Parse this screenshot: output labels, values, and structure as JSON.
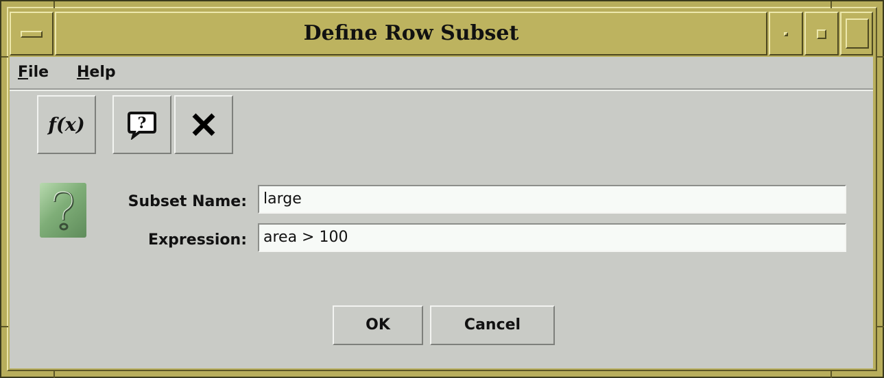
{
  "window": {
    "title": "Define Row Subset"
  },
  "menu": {
    "file": {
      "mnemonic": "F",
      "rest": "ile"
    },
    "help": {
      "mnemonic": "H",
      "rest": "elp"
    }
  },
  "toolbar": {
    "functions_label": "f(x)",
    "help_label": "?",
    "close_label": "✕"
  },
  "form": {
    "subset_name_label": "Subset Name:",
    "subset_name_value": "large",
    "expression_label": "Expression:",
    "expression_value": "area > 100"
  },
  "buttons": {
    "ok_label": "OK",
    "cancel_label": "Cancel"
  },
  "icons": {
    "window_menu": "window-menu-icon",
    "minimize": "minimize-icon",
    "restore": "restore-icon",
    "maximize": "maximize-icon",
    "functions": "function-icon",
    "help": "help-bubble-icon",
    "close": "close-icon",
    "form_help": "question-mark-icon"
  },
  "colors": {
    "frame": "#b8ae5c",
    "background": "#c9cbc6",
    "field": "#f7faf7",
    "help_badge": "#7fae78"
  }
}
